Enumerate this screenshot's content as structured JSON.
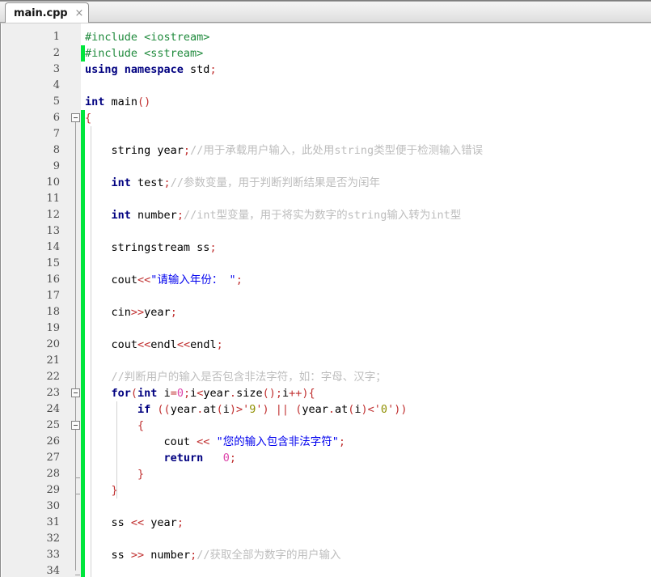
{
  "window": {
    "title": "main.cpp"
  },
  "tabbar": {
    "tabs": [
      {
        "label": "main.cpp",
        "close_glyph": "×",
        "active": true
      }
    ]
  },
  "editor": {
    "language": "C++",
    "first_visible_line": 1,
    "last_visible_line": 34,
    "line_height_px": 20,
    "colors": {
      "background": "#ffffff",
      "gutter_background": "#efefef",
      "gutter_text": "#4a4a4a",
      "change_bar": "#00e63c",
      "keyword": "#000080",
      "preprocessor": "#1f8a3c",
      "comment": "#bdbdbd",
      "string": "#0000ee",
      "char_literal": "#8f8f00",
      "operator": "#c03030",
      "number": "#dd44aa",
      "identifier": "#000000"
    },
    "line_numbers": [
      1,
      2,
      3,
      4,
      5,
      6,
      7,
      8,
      9,
      10,
      11,
      12,
      13,
      14,
      15,
      16,
      17,
      18,
      19,
      20,
      21,
      22,
      23,
      24,
      25,
      26,
      27,
      28,
      29,
      30,
      31,
      32,
      33,
      34
    ],
    "fold_markers": [
      {
        "line": 6,
        "state": "expanded"
      },
      {
        "line": 23,
        "state": "expanded"
      },
      {
        "line": 25,
        "state": "expanded"
      }
    ],
    "change_bars": [
      {
        "from_line": 2,
        "to_line": 2
      },
      {
        "from_line": 6,
        "to_line": 34
      }
    ],
    "lines": [
      {
        "n": 1,
        "text": "#include <iostream>",
        "tokens": [
          {
            "t": "#include <iostream>",
            "c": "pp"
          }
        ]
      },
      {
        "n": 2,
        "text": "#include <sstream>",
        "tokens": [
          {
            "t": "#include <sstream>",
            "c": "pp"
          }
        ]
      },
      {
        "n": 3,
        "text": "using namespace std;",
        "tokens": [
          {
            "t": "using namespace",
            "c": "k"
          },
          {
            "t": " std",
            "c": "id"
          },
          {
            "t": ";",
            "c": "op"
          }
        ]
      },
      {
        "n": 4,
        "text": "",
        "tokens": []
      },
      {
        "n": 5,
        "text": "int main()",
        "tokens": [
          {
            "t": "int",
            "c": "k"
          },
          {
            "t": " main",
            "c": "id"
          },
          {
            "t": "()",
            "c": "op"
          }
        ]
      },
      {
        "n": 6,
        "text": "{",
        "tokens": [
          {
            "t": "{",
            "c": "op"
          }
        ]
      },
      {
        "n": 7,
        "text": "",
        "tokens": []
      },
      {
        "n": 8,
        "text": "    string year;//用于承载用户输入，此处用string类型便于检测输入错误",
        "tokens": [
          {
            "t": "    string year",
            "c": "id"
          },
          {
            "t": ";",
            "c": "op"
          },
          {
            "t": "//用于承载用户输入，此处用string类型便于检测输入错误",
            "c": "cm"
          }
        ]
      },
      {
        "n": 9,
        "text": "",
        "tokens": []
      },
      {
        "n": 10,
        "text": "    int test;//参数变量，用于判断判断结果是否为闰年",
        "tokens": [
          {
            "t": "    ",
            "c": "id"
          },
          {
            "t": "int",
            "c": "k"
          },
          {
            "t": " test",
            "c": "id"
          },
          {
            "t": ";",
            "c": "op"
          },
          {
            "t": "//参数变量，用于判断判断结果是否为闰年",
            "c": "cm"
          }
        ]
      },
      {
        "n": 11,
        "text": "",
        "tokens": []
      },
      {
        "n": 12,
        "text": "    int number;//int型变量，用于将实为数字的string输入转为int型",
        "tokens": [
          {
            "t": "    ",
            "c": "id"
          },
          {
            "t": "int",
            "c": "k"
          },
          {
            "t": " number",
            "c": "id"
          },
          {
            "t": ";",
            "c": "op"
          },
          {
            "t": "//int型变量，用于将实为数字的string输入转为int型",
            "c": "cm"
          }
        ]
      },
      {
        "n": 13,
        "text": "",
        "tokens": []
      },
      {
        "n": 14,
        "text": "    stringstream ss;",
        "tokens": [
          {
            "t": "    stringstream ss",
            "c": "id"
          },
          {
            "t": ";",
            "c": "op"
          }
        ]
      },
      {
        "n": 15,
        "text": "",
        "tokens": []
      },
      {
        "n": 16,
        "text": "    cout<<\"请输入年份： \";",
        "tokens": [
          {
            "t": "    cout",
            "c": "id"
          },
          {
            "t": "<<",
            "c": "op"
          },
          {
            "t": "\"请输入年份： \"",
            "c": "str"
          },
          {
            "t": ";",
            "c": "op"
          }
        ]
      },
      {
        "n": 17,
        "text": "",
        "tokens": []
      },
      {
        "n": 18,
        "text": "    cin>>year;",
        "tokens": [
          {
            "t": "    cin",
            "c": "id"
          },
          {
            "t": ">>",
            "c": "op"
          },
          {
            "t": "year",
            "c": "id"
          },
          {
            "t": ";",
            "c": "op"
          }
        ]
      },
      {
        "n": 19,
        "text": "",
        "tokens": []
      },
      {
        "n": 20,
        "text": "    cout<<endl<<endl;",
        "tokens": [
          {
            "t": "    cout",
            "c": "id"
          },
          {
            "t": "<<",
            "c": "op"
          },
          {
            "t": "endl",
            "c": "id"
          },
          {
            "t": "<<",
            "c": "op"
          },
          {
            "t": "endl",
            "c": "id"
          },
          {
            "t": ";",
            "c": "op"
          }
        ]
      },
      {
        "n": 21,
        "text": "",
        "tokens": []
      },
      {
        "n": 22,
        "text": "    //判断用户的输入是否包含非法字符，如：字母、汉字；",
        "tokens": [
          {
            "t": "    ",
            "c": "id"
          },
          {
            "t": "//判断用户的输入是否包含非法字符，如：字母、汉字；",
            "c": "cm"
          }
        ]
      },
      {
        "n": 23,
        "text": "    for(int i=0;i<year.size();i++){",
        "tokens": [
          {
            "t": "    ",
            "c": "id"
          },
          {
            "t": "for",
            "c": "k"
          },
          {
            "t": "(",
            "c": "op"
          },
          {
            "t": "int",
            "c": "k"
          },
          {
            "t": " i",
            "c": "id"
          },
          {
            "t": "=",
            "c": "op"
          },
          {
            "t": "0",
            "c": "num"
          },
          {
            "t": ";",
            "c": "op"
          },
          {
            "t": "i",
            "c": "id"
          },
          {
            "t": "<",
            "c": "op"
          },
          {
            "t": "year",
            "c": "id"
          },
          {
            "t": ".",
            "c": "op"
          },
          {
            "t": "size",
            "c": "id"
          },
          {
            "t": "();",
            "c": "op"
          },
          {
            "t": "i",
            "c": "id"
          },
          {
            "t": "++){",
            "c": "op"
          }
        ]
      },
      {
        "n": 24,
        "text": "        if ((year.at(i)>'9') || (year.at(i)<'0'))",
        "tokens": [
          {
            "t": "        ",
            "c": "id"
          },
          {
            "t": "if",
            "c": "k"
          },
          {
            "t": " ((",
            "c": "op"
          },
          {
            "t": "year",
            "c": "id"
          },
          {
            "t": ".",
            "c": "op"
          },
          {
            "t": "at",
            "c": "id"
          },
          {
            "t": "(",
            "c": "op"
          },
          {
            "t": "i",
            "c": "id"
          },
          {
            "t": ")>'",
            "c": "op"
          },
          {
            "t": "9",
            "c": "chl"
          },
          {
            "t": "') || (",
            "c": "op"
          },
          {
            "t": "year",
            "c": "id"
          },
          {
            "t": ".",
            "c": "op"
          },
          {
            "t": "at",
            "c": "id"
          },
          {
            "t": "(",
            "c": "op"
          },
          {
            "t": "i",
            "c": "id"
          },
          {
            "t": ")<'",
            "c": "op"
          },
          {
            "t": "0",
            "c": "chl"
          },
          {
            "t": "'))",
            "c": "op"
          }
        ]
      },
      {
        "n": 25,
        "text": "        {",
        "tokens": [
          {
            "t": "        ",
            "c": "id"
          },
          {
            "t": "{",
            "c": "op"
          }
        ]
      },
      {
        "n": 26,
        "text": "            cout << \"您的输入包含非法字符\";",
        "tokens": [
          {
            "t": "            cout ",
            "c": "id"
          },
          {
            "t": "<<",
            "c": "op"
          },
          {
            "t": " ",
            "c": "id"
          },
          {
            "t": "\"您的输入包含非法字符\"",
            "c": "str"
          },
          {
            "t": ";",
            "c": "op"
          }
        ]
      },
      {
        "n": 27,
        "text": "            return   0;",
        "tokens": [
          {
            "t": "            ",
            "c": "id"
          },
          {
            "t": "return",
            "c": "k"
          },
          {
            "t": "   ",
            "c": "id"
          },
          {
            "t": "0",
            "c": "num"
          },
          {
            "t": ";",
            "c": "op"
          }
        ]
      },
      {
        "n": 28,
        "text": "        }",
        "tokens": [
          {
            "t": "        ",
            "c": "id"
          },
          {
            "t": "}",
            "c": "op"
          }
        ]
      },
      {
        "n": 29,
        "text": "    }",
        "tokens": [
          {
            "t": "    ",
            "c": "id"
          },
          {
            "t": "}",
            "c": "op"
          }
        ]
      },
      {
        "n": 30,
        "text": "",
        "tokens": []
      },
      {
        "n": 31,
        "text": "    ss << year;",
        "tokens": [
          {
            "t": "    ss ",
            "c": "id"
          },
          {
            "t": "<<",
            "c": "op"
          },
          {
            "t": " year",
            "c": "id"
          },
          {
            "t": ";",
            "c": "op"
          }
        ]
      },
      {
        "n": 32,
        "text": "",
        "tokens": []
      },
      {
        "n": 33,
        "text": "    ss >> number;//获取全部为数字的用户输入",
        "tokens": [
          {
            "t": "    ss ",
            "c": "id"
          },
          {
            "t": ">>",
            "c": "op"
          },
          {
            "t": " number",
            "c": "id"
          },
          {
            "t": ";",
            "c": "op"
          },
          {
            "t": "//获取全部为数字的用户输入",
            "c": "cm"
          }
        ]
      },
      {
        "n": 34,
        "text": "",
        "tokens": []
      }
    ]
  }
}
